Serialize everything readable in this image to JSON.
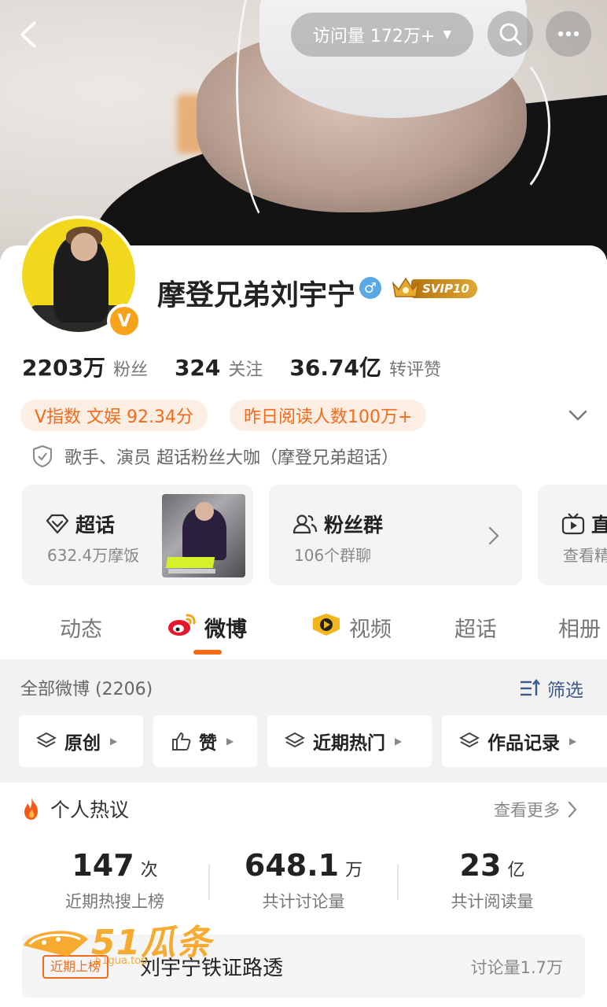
{
  "header": {
    "visit_label": "访问量 172万+"
  },
  "profile": {
    "username": "摩登兄弟刘宇宁",
    "gender_symbol": "♂",
    "svip_label": "SVIP10",
    "verified_badge": "V",
    "stats": [
      {
        "value": "2203万",
        "label": "粉丝"
      },
      {
        "value": "324",
        "label": "关注"
      },
      {
        "value": "36.74亿",
        "label": "转评赞"
      }
    ],
    "chips": [
      "V指数 文娱 92.34分",
      "昨日阅读人数100万+"
    ],
    "verification": "歌手、演员 超话粉丝大咖（摩登兄弟超话）"
  },
  "features": [
    {
      "title": "超话",
      "subtitle": "632.4万摩饭",
      "icon": "supertopic-icon"
    },
    {
      "title": "粉丝群",
      "subtitle": "106个群聊",
      "icon": "fans-group-icon"
    },
    {
      "title": "直",
      "subtitle": "查看精",
      "icon": "live-tv-icon"
    }
  ],
  "tabs": [
    "动态",
    "微博",
    "视频",
    "超话",
    "相册"
  ],
  "active_tab": "微博",
  "posts": {
    "all_label": "全部微博 (2206)",
    "filter_label": "筛选",
    "filters": [
      "原创",
      "赞",
      "近期热门",
      "作品记录"
    ]
  },
  "hot": {
    "title": "个人热议",
    "see_more": "查看更多",
    "metrics": [
      {
        "num": "147",
        "unit": "次",
        "label": "近期热搜上榜"
      },
      {
        "num": "648.1",
        "unit": "万",
        "label": "共计讨论量"
      },
      {
        "num": "23",
        "unit": "亿",
        "label": "共计阅读量"
      }
    ],
    "item": {
      "tag": "近期上榜",
      "title": "刘宇宁铁证路透",
      "count": "讨论量1.7万"
    }
  },
  "colors": {
    "accent": "#f76b12",
    "chip_bg": "#fdeee3",
    "link_blue": "#3d5a8c",
    "vip_gold": "#e0a633"
  },
  "watermark": {
    "text": "51瓜条",
    "small": "51gua.top"
  }
}
